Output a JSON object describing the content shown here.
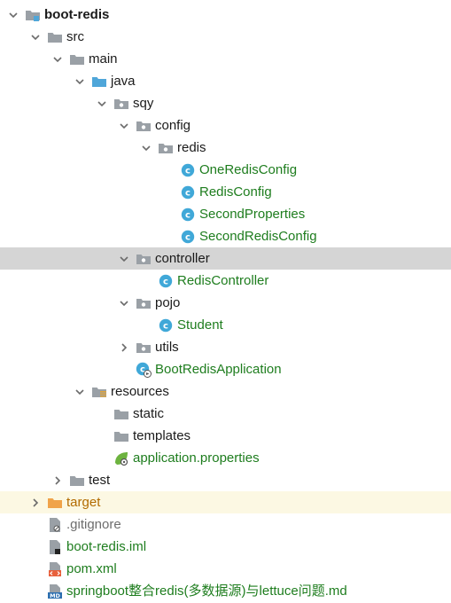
{
  "tree": [
    {
      "name": "boot-redis",
      "depth": 0,
      "arrow": "down",
      "icon": "module-folder-icon",
      "bold": true,
      "color": "dark"
    },
    {
      "name": "src",
      "depth": 1,
      "arrow": "down",
      "icon": "folder-icon",
      "color": "dark"
    },
    {
      "name": "main",
      "depth": 2,
      "arrow": "down",
      "icon": "folder-icon",
      "color": "dark"
    },
    {
      "name": "java",
      "depth": 3,
      "arrow": "down",
      "icon": "source-folder-icon",
      "color": "dark"
    },
    {
      "name": "sqy",
      "depth": 4,
      "arrow": "down",
      "icon": "package-icon",
      "color": "dark"
    },
    {
      "name": "config",
      "depth": 5,
      "arrow": "down",
      "icon": "package-icon",
      "color": "dark"
    },
    {
      "name": "redis",
      "depth": 6,
      "arrow": "down",
      "icon": "package-icon",
      "color": "dark"
    },
    {
      "name": "OneRedisConfig",
      "depth": 7,
      "arrow": "none",
      "icon": "class-icon",
      "color": "green"
    },
    {
      "name": "RedisConfig",
      "depth": 7,
      "arrow": "none",
      "icon": "class-icon",
      "color": "green"
    },
    {
      "name": "SecondProperties",
      "depth": 7,
      "arrow": "none",
      "icon": "class-icon",
      "color": "green"
    },
    {
      "name": "SecondRedisConfig",
      "depth": 7,
      "arrow": "none",
      "icon": "class-icon",
      "color": "green"
    },
    {
      "name": "controller",
      "depth": 5,
      "arrow": "down",
      "icon": "package-icon",
      "color": "dark",
      "selected": true
    },
    {
      "name": "RedisController",
      "depth": 6,
      "arrow": "none",
      "icon": "class-icon",
      "color": "green"
    },
    {
      "name": "pojo",
      "depth": 5,
      "arrow": "down",
      "icon": "package-icon",
      "color": "dark"
    },
    {
      "name": "Student",
      "depth": 6,
      "arrow": "none",
      "icon": "class-icon",
      "color": "green"
    },
    {
      "name": "utils",
      "depth": 5,
      "arrow": "right",
      "icon": "package-icon",
      "color": "dark"
    },
    {
      "name": "BootRedisApplication",
      "depth": 5,
      "arrow": "none",
      "icon": "spring-boot-class-icon",
      "color": "green"
    },
    {
      "name": "resources",
      "depth": 3,
      "arrow": "down",
      "icon": "resources-folder-icon",
      "color": "dark"
    },
    {
      "name": "static",
      "depth": 4,
      "arrow": "none",
      "icon": "folder-icon",
      "color": "dark"
    },
    {
      "name": "templates",
      "depth": 4,
      "arrow": "none",
      "icon": "folder-icon",
      "color": "dark"
    },
    {
      "name": "application.properties",
      "depth": 4,
      "arrow": "none",
      "icon": "spring-properties-icon",
      "color": "green"
    },
    {
      "name": "test",
      "depth": 2,
      "arrow": "right",
      "icon": "folder-icon",
      "color": "dark"
    },
    {
      "name": "target",
      "depth": 1,
      "arrow": "right",
      "icon": "excluded-folder-icon",
      "color": "orange",
      "ignored": true
    },
    {
      "name": ".gitignore",
      "depth": 1,
      "arrow": "none",
      "icon": "ignore-file-icon",
      "color": "gray"
    },
    {
      "name": "boot-redis.iml",
      "depth": 1,
      "arrow": "none",
      "icon": "iml-file-icon",
      "color": "green"
    },
    {
      "name": "pom.xml",
      "depth": 1,
      "arrow": "none",
      "icon": "xml-file-icon",
      "color": "green"
    },
    {
      "name": "springboot整合redis(多数据源)与lettuce问题.md",
      "depth": 1,
      "arrow": "none",
      "icon": "markdown-file-icon",
      "icon_text": "MD",
      "color": "green"
    }
  ],
  "colors": {
    "folder": "#9aa0a6",
    "source_folder": "#4fa6d9",
    "class_circle": "#40a8d8",
    "orange_folder": "#f0a34a",
    "selection": "#d5d5d5",
    "ignored_row": "#fcf8e3",
    "green_text": "#1e7d1e"
  }
}
